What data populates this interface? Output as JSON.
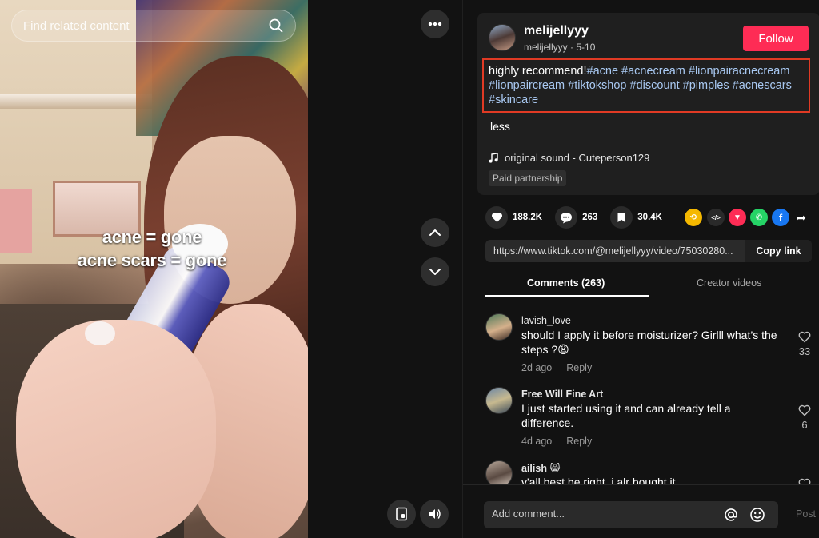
{
  "search": {
    "placeholder": "Find related content",
    "icon": "search-icon"
  },
  "video": {
    "overlay_line1": "acne = gone",
    "overlay_line2": "acne scars = gone"
  },
  "controls": {
    "more": "more-icon",
    "prev": "chevron-up-icon",
    "next": "chevron-down-icon",
    "floating": "floating-player-icon",
    "volume": "volume-icon"
  },
  "author": {
    "name": "melijellyyy",
    "handle": "melijellyyy",
    "separator": " · ",
    "date": "5-10",
    "follow_label": "Follow"
  },
  "description": {
    "text": "highly recommend!",
    "hashtags": [
      "#acne",
      "#acnecream",
      "#lionpairacnecream",
      "#lionpaircream",
      "#tiktokshop",
      "#discount",
      "#pimples",
      "#acnescars",
      "#skincare"
    ],
    "less_label": "less"
  },
  "sound": {
    "label": "original sound - Cuteperson129"
  },
  "paid_label": "Paid partnership",
  "stats": {
    "likes": "188.2K",
    "comments": "263",
    "saves": "30.4K"
  },
  "share_icons": [
    "repost-icon",
    "embed-icon",
    "send-icon",
    "whatsapp-icon",
    "facebook-icon",
    "share-arrow-icon"
  ],
  "link": {
    "url": "https://www.tiktok.com/@melijellyyy/video/75030280...",
    "copy_label": "Copy link"
  },
  "tabs": {
    "comments": "Comments (263)",
    "creator": "Creator videos"
  },
  "comments": [
    {
      "user": "lavish_love",
      "text": "should I apply it before moisturizer? Girlll what’s the steps ?😩",
      "time": "2d ago",
      "reply": "Reply",
      "likes": "33"
    },
    {
      "user": "Free Will Fine Art",
      "text": "I just started using it and can already tell a difference.",
      "time": "4d ago",
      "reply": "Reply",
      "likes": "6"
    },
    {
      "user": "ailish 😸",
      "text": "y'all best be right. i alr bought it",
      "time": "",
      "reply": "",
      "likes": ""
    }
  ],
  "comment_bar": {
    "placeholder": "Add comment...",
    "post_label": "Post"
  },
  "colors": {
    "accent": "#fe2c55",
    "hashtag": "#a9c9f2",
    "highlight_border": "#e03a24",
    "background": "#121212"
  }
}
